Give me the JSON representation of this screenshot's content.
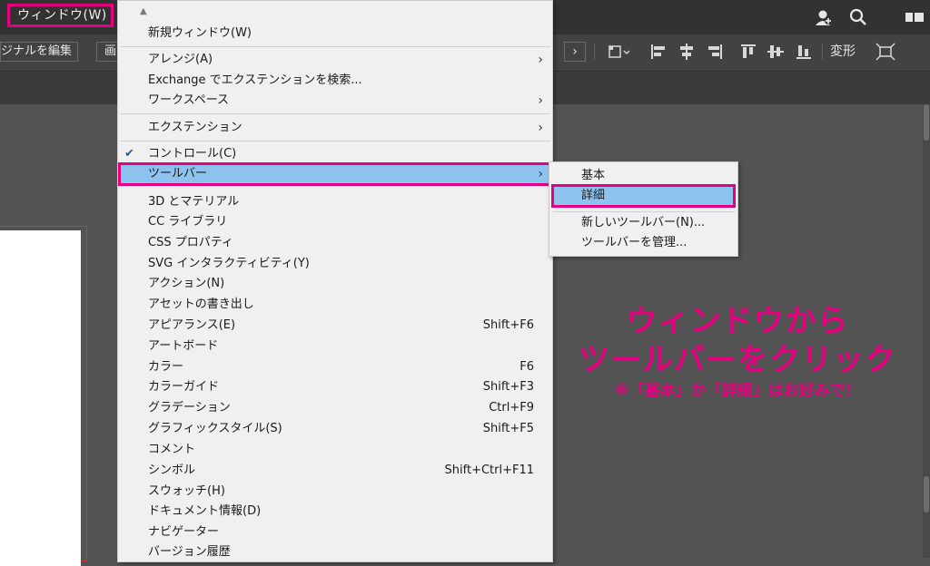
{
  "menubar": {
    "title": "ウィンドウ(W)"
  },
  "top_icons": [
    "user-add-icon",
    "search-icon",
    "panel-layout-icon"
  ],
  "controlbar": {
    "edit_original": "ジナルを編集",
    "second_button": "画",
    "chevron": "›",
    "transform_label": "変形"
  },
  "dropdown": {
    "scroll_up": "▲",
    "items": [
      {
        "label": "新規ウィンドウ(W)",
        "shortcut": "",
        "submenu": false
      },
      {
        "label": "アレンジ(A)",
        "shortcut": "",
        "submenu": true
      },
      {
        "label": "Exchange でエクステンションを検索...",
        "shortcut": "",
        "submenu": false
      },
      {
        "label": "ワークスペース",
        "shortcut": "",
        "submenu": true
      },
      {
        "label": "エクステンション",
        "shortcut": "",
        "submenu": true
      },
      {
        "label": "コントロール(C)",
        "shortcut": "",
        "submenu": false,
        "checked": true
      },
      {
        "label": "ツールバー",
        "shortcut": "",
        "submenu": true,
        "highlighted": true
      },
      {
        "label": "3D とマテリアル",
        "shortcut": ""
      },
      {
        "label": "CC ライブラリ",
        "shortcut": ""
      },
      {
        "label": "CSS プロパティ",
        "shortcut": ""
      },
      {
        "label": "SVG インタラクティビティ(Y)",
        "shortcut": ""
      },
      {
        "label": "アクション(N)",
        "shortcut": ""
      },
      {
        "label": "アセットの書き出し",
        "shortcut": ""
      },
      {
        "label": "アピアランス(E)",
        "shortcut": "Shift+F6"
      },
      {
        "label": "アートボード",
        "shortcut": ""
      },
      {
        "label": "カラー",
        "shortcut": "F6"
      },
      {
        "label": "カラーガイド",
        "shortcut": "Shift+F3"
      },
      {
        "label": "グラデーション",
        "shortcut": "Ctrl+F9"
      },
      {
        "label": "グラフィックスタイル(S)",
        "shortcut": "Shift+F5"
      },
      {
        "label": "コメント",
        "shortcut": ""
      },
      {
        "label": "シンボル",
        "shortcut": "Shift+Ctrl+F11"
      },
      {
        "label": "スウォッチ(H)",
        "shortcut": ""
      },
      {
        "label": "ドキュメント情報(D)",
        "shortcut": ""
      },
      {
        "label": "ナビゲーター",
        "shortcut": ""
      },
      {
        "label": "バージョン履歴",
        "shortcut": ""
      }
    ],
    "check_mark": "✔",
    "arrow": "›"
  },
  "submenu": {
    "items": [
      {
        "label": "基本"
      },
      {
        "label": "詳細",
        "highlighted": true
      },
      {
        "label": "新しいツールバー(N)..."
      },
      {
        "label": "ツールバーを管理..."
      }
    ]
  },
  "annotation": {
    "line1": "ウィンドウから",
    "line2": "ツールバーをクリック",
    "line3": "※「基本」か「詳細」はお好みで！"
  },
  "colors": {
    "highlight_border": "#e5007f",
    "highlight_fill": "#8ec3f0",
    "annotation": "#e5007f"
  }
}
